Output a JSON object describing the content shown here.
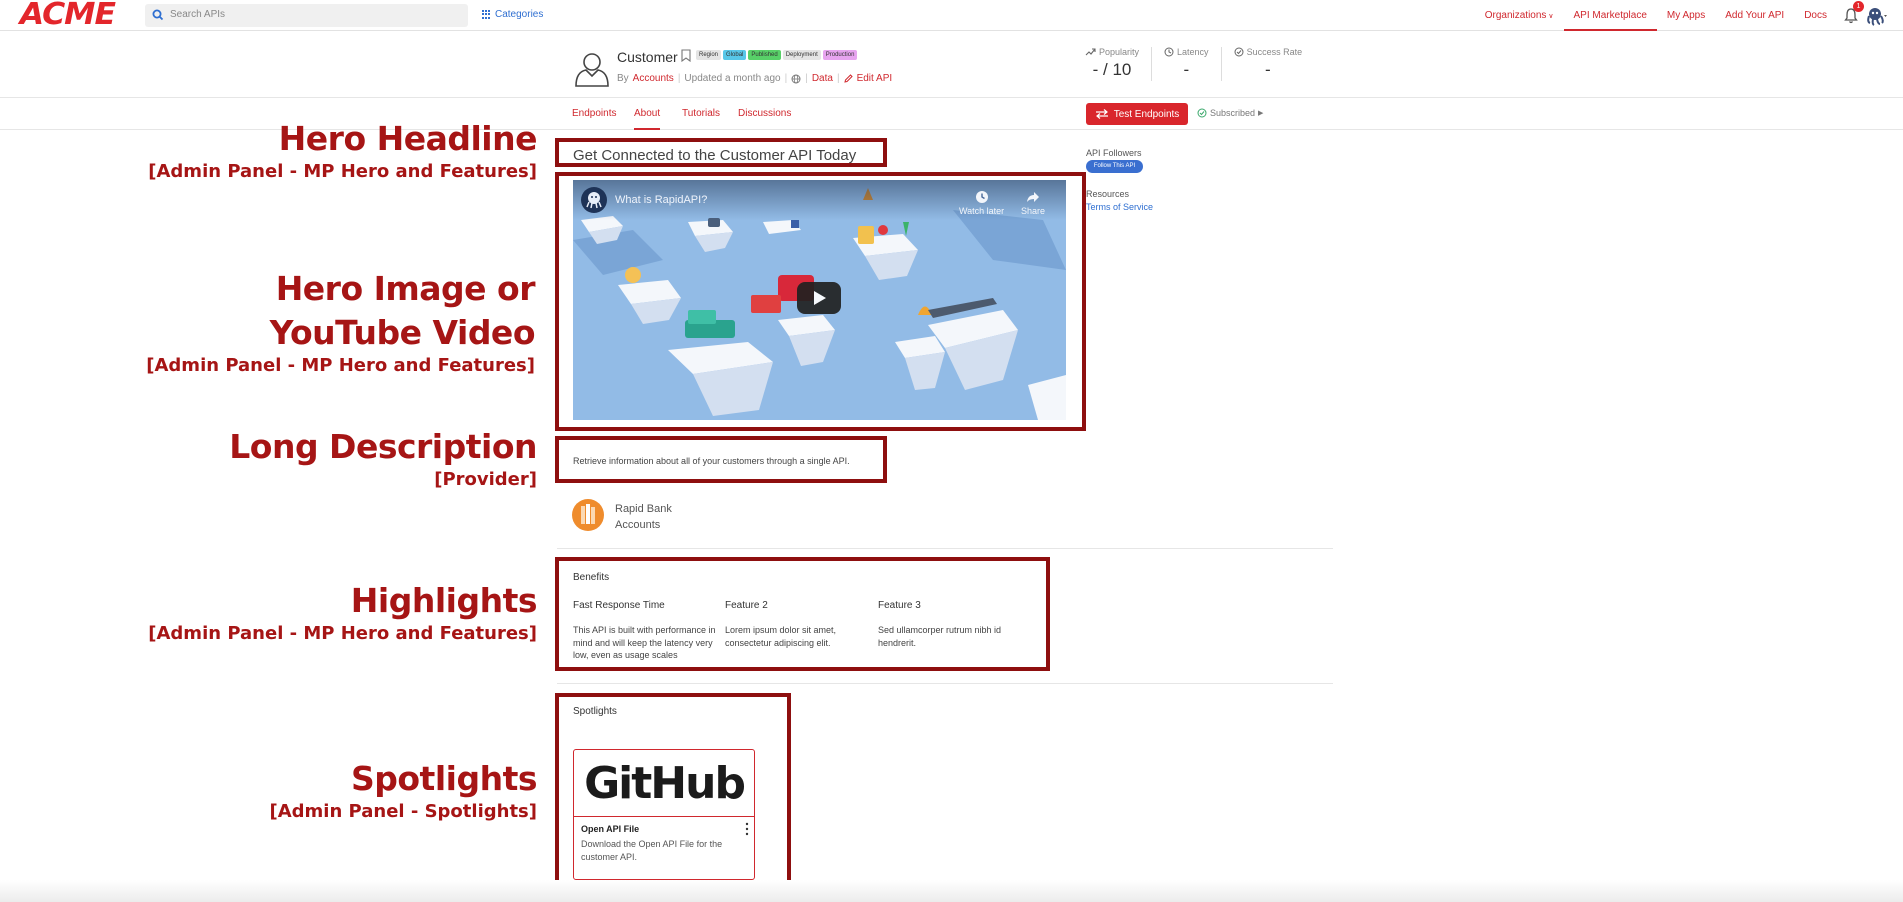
{
  "nav": {
    "logo": "ACME",
    "search_placeholder": "Search APIs",
    "categories": "Categories",
    "links": [
      "Organizations",
      "API Marketplace",
      "My Apps",
      "Add Your API",
      "Docs"
    ],
    "active_link": "API Marketplace",
    "notification_count": "1",
    "accent": "#d0282e"
  },
  "api": {
    "name": "Customer",
    "tags": [
      "Region",
      "Global",
      "Published",
      "Deployment",
      "Production"
    ],
    "by": "By",
    "owner": "Accounts",
    "updated": "Updated a month ago",
    "data_link": "Data",
    "edit_link": "Edit API",
    "stats": [
      {
        "label": "Popularity",
        "value": "- / 10"
      },
      {
        "label": "Latency",
        "value": "-"
      },
      {
        "label": "Success Rate",
        "value": "-"
      }
    ]
  },
  "tabs": [
    "Endpoints",
    "About",
    "Tutorials",
    "Discussions"
  ],
  "active_tab": "About",
  "actions": {
    "test_endpoints": "Test Endpoints",
    "subscribed": "Subscribed"
  },
  "annotations": {
    "hero_headline": {
      "title": "Hero Headline",
      "sub": "[Admin Panel - MP Hero and Features]"
    },
    "hero_image": {
      "title1": "Hero Image or",
      "title2": "YouTube Video",
      "sub": "[Admin Panel - MP Hero and Features]"
    },
    "long_description": {
      "title": "Long Description",
      "sub": "[Provider]"
    },
    "highlights": {
      "title": "Highlights",
      "sub": "[Admin Panel - MP Hero and Features]"
    },
    "spotlights": {
      "title": "Spotlights",
      "sub": "[Admin Panel - Spotlights]"
    }
  },
  "hero": {
    "headline": "Get Connected to the Customer API Today",
    "video_title": "What is RapidAPI?",
    "watch_later": "Watch later",
    "share": "Share"
  },
  "description": "Retrieve information about all of your customers through a single API.",
  "provider": {
    "line1": "Rapid Bank",
    "line2": "Accounts"
  },
  "benefits": {
    "title": "Benefits",
    "features": [
      {
        "title": "Fast Response Time",
        "desc": "This API is built with performance in mind and will keep the latency very low, even as usage scales"
      },
      {
        "title": "Feature 2",
        "desc": "Lorem ipsum dolor sit amet, consectetur adipiscing elit."
      },
      {
        "title": "Feature 3",
        "desc": "Sed ullamcorper rutrum nibh id hendrerit."
      }
    ]
  },
  "spotlights": {
    "title": "Spotlights",
    "card": {
      "logo": "GitHub",
      "title": "Open API File",
      "desc": "Download the Open API File for the customer API."
    }
  },
  "sidebar": {
    "followers_label": "API Followers",
    "follow_button": "Follow This API",
    "resources_label": "Resources",
    "terms": "Terms of Service"
  }
}
